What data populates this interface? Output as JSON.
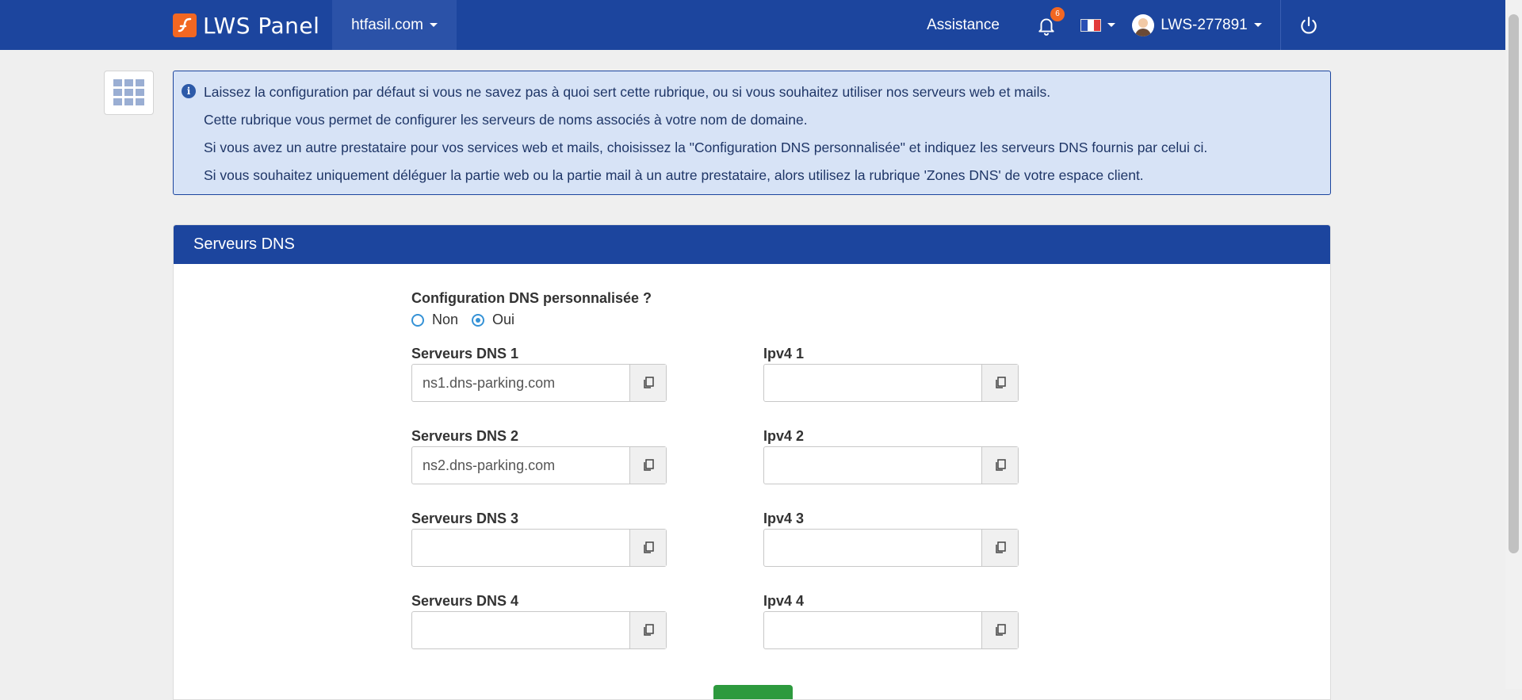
{
  "nav": {
    "logo_text": "LWS Panel",
    "domain": "htfasil.com",
    "assistance": "Assistance",
    "notifications_count": "6",
    "language_flag": "fr-flag-icon",
    "user": "LWS-277891"
  },
  "info": {
    "lines": [
      "Laissez la configuration par défaut si vous ne savez pas à quoi sert cette rubrique, ou si vous souhaitez utiliser nos serveurs web et mails.",
      "Cette rubrique vous permet de configurer les serveurs de noms associés à votre nom de domaine.",
      "Si vous avez un autre prestataire pour vos services web et mails, choisissez la \"Configuration DNS personnalisée\" et indiquez les serveurs DNS fournis par celui ci.",
      "Si vous souhaitez uniquement déléguer la partie web ou la partie mail à un autre prestataire, alors utilisez la rubrique 'Zones DNS' de votre espace client."
    ]
  },
  "panel": {
    "title": "Serveurs DNS",
    "question": "Configuration DNS personnalisée ?",
    "options": [
      "Non",
      "Oui"
    ],
    "selected": "Oui",
    "dns_fields": [
      {
        "label": "Serveurs DNS 1",
        "value": "ns1.dns-parking.com"
      },
      {
        "label": "Serveurs DNS 2",
        "value": "ns2.dns-parking.com"
      },
      {
        "label": "Serveurs DNS 3",
        "value": ""
      },
      {
        "label": "Serveurs DNS 4",
        "value": ""
      }
    ],
    "ip_fields": [
      {
        "label": "Ipv4 1",
        "value": ""
      },
      {
        "label": "Ipv4 2",
        "value": ""
      },
      {
        "label": "Ipv4 3",
        "value": ""
      },
      {
        "label": "Ipv4 4",
        "value": ""
      }
    ]
  },
  "colors": {
    "nav_bg": "#1c459e",
    "accent_orange": "#f26722",
    "info_bg": "#d7e3f6",
    "radio_blue": "#3592d6",
    "save_green": "#2d9a3e"
  }
}
